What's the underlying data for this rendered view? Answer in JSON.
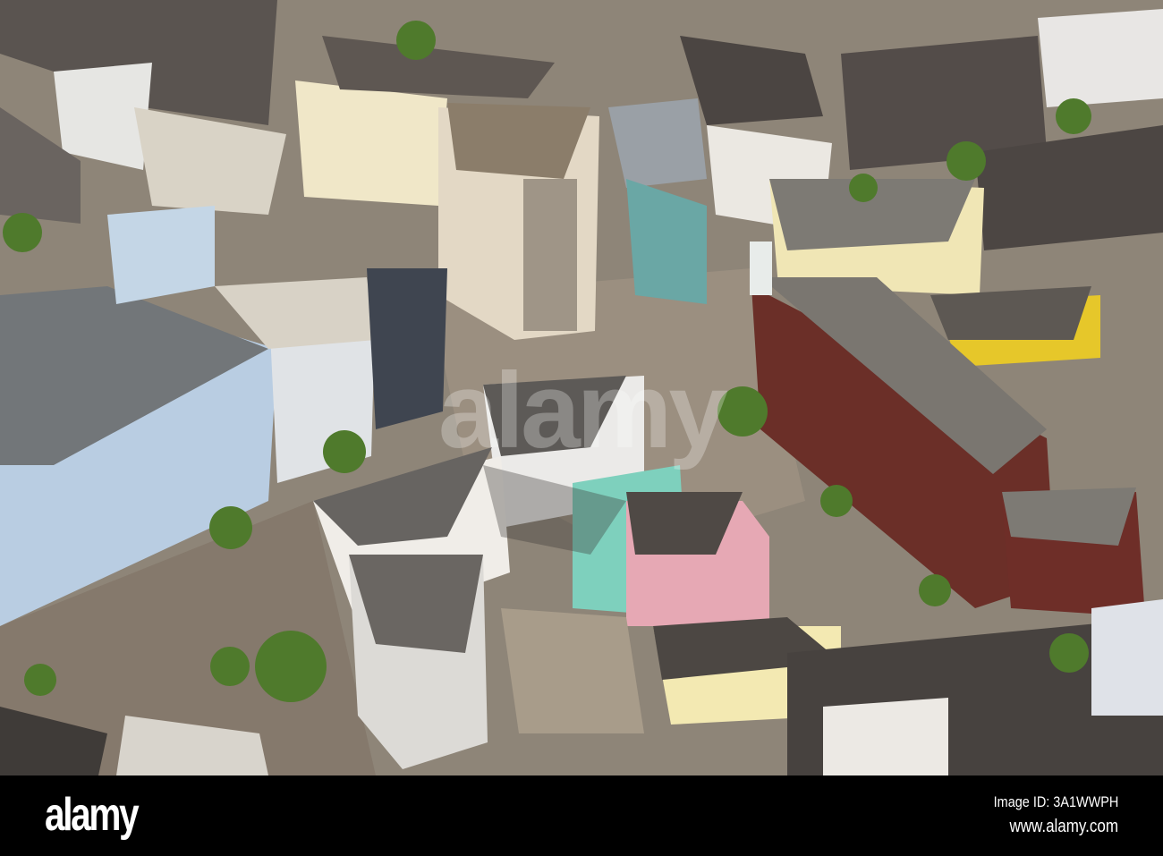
{
  "photo": {
    "subject": "aerial-city-square",
    "colors": {
      "street": "#8e8578",
      "roof_dark": "#4a4643",
      "roof_flat": "#7d7a74",
      "facade_white": "#dfe3e6",
      "facade_blue": "#b9cde2",
      "brick": "#6b2f28",
      "tree": "#4f7a2c",
      "shadow": "#3a3634"
    }
  },
  "watermark": {
    "text": "alamy"
  },
  "footer": {
    "logo": "alamy",
    "image_id": "Image ID: 3A1WWPH",
    "website": "www.alamy.com"
  }
}
